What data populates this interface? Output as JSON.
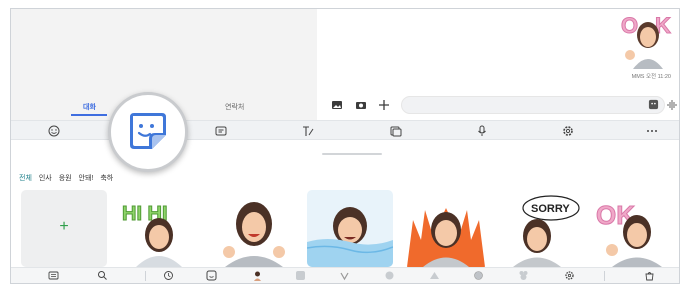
{
  "tabs": {
    "chats": "대화",
    "contacts": "연락처"
  },
  "message": {
    "meta": "MMS 오전 11:20"
  },
  "categories": [
    "전체",
    "인사",
    "응원",
    "안돼!",
    "축하"
  ],
  "icons": {
    "composer": [
      "gallery-icon",
      "camera-icon",
      "add-icon",
      "sticker-icon",
      "voice-icon"
    ],
    "toolbar": [
      "emoji-icon",
      "sticker-icon",
      "gif-icon",
      "handwriting-icon",
      "clipboard-icon",
      "mic-icon",
      "settings-icon",
      "more-icon"
    ],
    "bottom": [
      "keyboard-icon",
      "search-icon",
      "recent-icon",
      "sticker-pack-icon",
      "avatar-icon",
      "pack-icon",
      "pack-icon",
      "pack-icon",
      "pack-icon",
      "pack-icon",
      "pack-icon",
      "settings-icon",
      "store-icon"
    ]
  },
  "stickers": [
    "HI HI",
    "",
    "",
    "",
    "SORRY",
    "OK"
  ],
  "colors": {
    "accent": "#3f6ee0",
    "active_category": "#1e7f8a",
    "add": "#2e9e4a"
  }
}
